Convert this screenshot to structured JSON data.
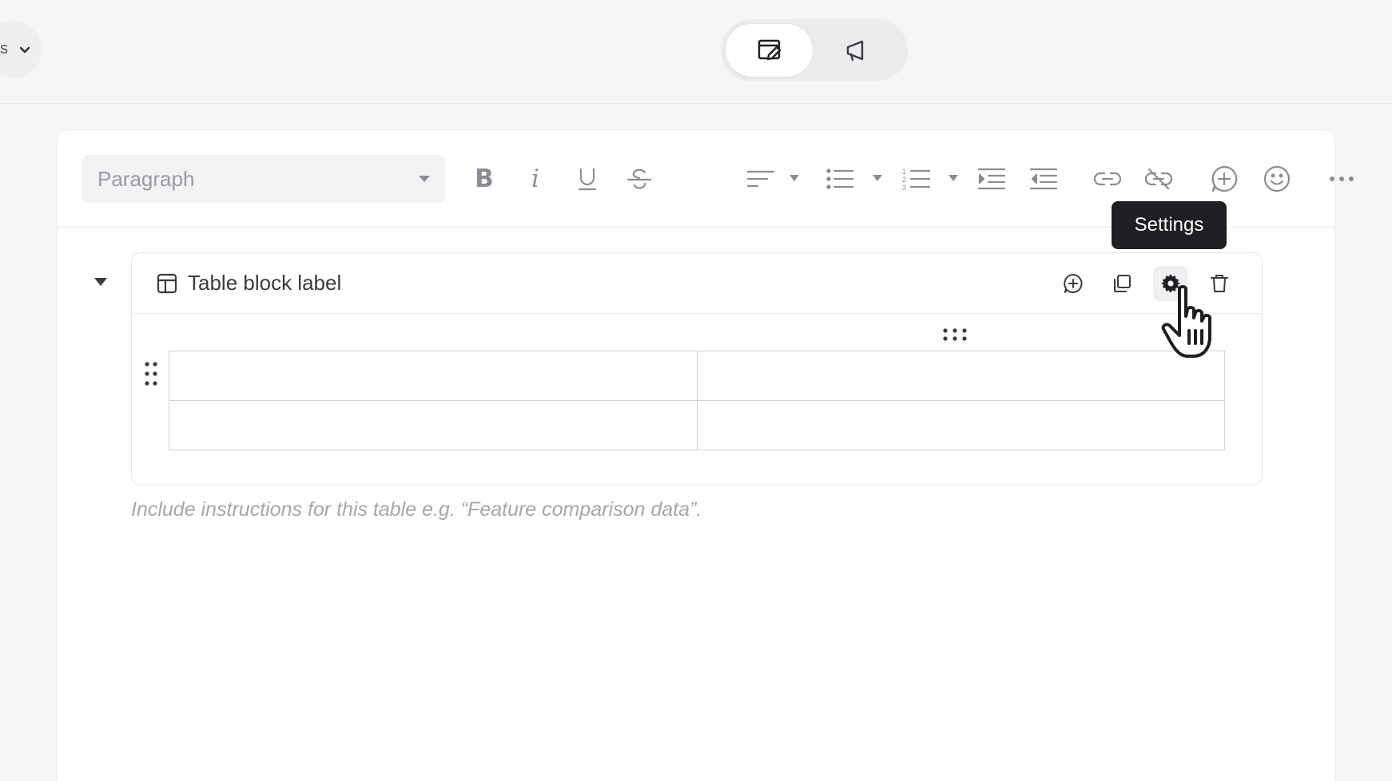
{
  "topbar": {
    "left_dropdown_text": "s",
    "mode_toggle": [
      {
        "name": "editor-mode",
        "icon": "edit-document-icon",
        "active": true
      },
      {
        "name": "publish-mode",
        "icon": "megaphone-icon",
        "active": false
      }
    ]
  },
  "toolbar": {
    "block_type_placeholder": "Paragraph",
    "bold_glyph": "B",
    "italic_glyph": "i",
    "underline_glyph": "U",
    "strikethrough_glyph": "S",
    "more_glyph": "•••"
  },
  "tooltip": {
    "text": "Settings"
  },
  "table_block": {
    "label": "Table block label",
    "rows": 2,
    "columns": 2,
    "actions": [
      "add-block-icon",
      "duplicate-icon",
      "gear-icon",
      "trash-icon"
    ],
    "instructions_placeholder": "Include instructions for this table e.g. “Feature comparison data”."
  }
}
